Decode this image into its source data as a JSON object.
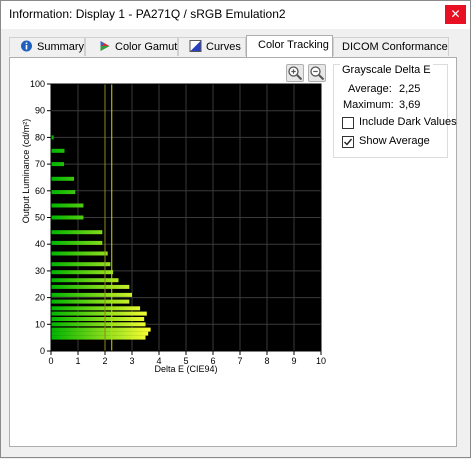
{
  "window": {
    "title": "Information: Display 1 - PA271Q / sRGB Emulation2",
    "close_glyph": "✕"
  },
  "tabs": [
    {
      "label": "Summary",
      "icon": "info-icon"
    },
    {
      "label": "Color Gamut",
      "icon": "gamut-icon"
    },
    {
      "label": "Curves",
      "icon": "curves-icon"
    },
    {
      "label": "Color Tracking",
      "icon": ""
    },
    {
      "label": "DICOM Conformance",
      "icon": ""
    }
  ],
  "active_tab": "Color Tracking",
  "stats": {
    "group_title": "Grayscale Delta E",
    "average_label": "Average:",
    "average_value": "2,25",
    "maximum_label": "Maximum:",
    "maximum_value": "3,69",
    "include_dark_label": "Include Dark Values",
    "include_dark_checked": false,
    "show_average_label": "Show Average",
    "show_average_checked": true
  },
  "chart_data": {
    "type": "bar",
    "orientation": "horizontal",
    "xlabel": "Delta E (CIE94)",
    "ylabel": "Output Luminance (cd/m²)",
    "xlim": [
      0,
      10
    ],
    "ylim": [
      0,
      100
    ],
    "xticks": [
      "0",
      "1",
      "2",
      "3",
      "4",
      "5",
      "6",
      "7",
      "8",
      "9",
      "10"
    ],
    "yticks": [
      "0",
      "10",
      "20",
      "30",
      "40",
      "50",
      "60",
      "70",
      "80",
      "90",
      "100"
    ],
    "average_line": 2.25,
    "average_line_color": "#d4d400",
    "background": "#000000",
    "grid": true,
    "bars": [
      {
        "y": 80.0,
        "x": 0.1
      },
      {
        "y": 75.0,
        "x": 0.5
      },
      {
        "y": 70.0,
        "x": 0.48
      },
      {
        "y": 64.5,
        "x": 0.85
      },
      {
        "y": 59.5,
        "x": 0.9
      },
      {
        "y": 54.5,
        "x": 1.2
      },
      {
        "y": 50.0,
        "x": 1.2
      },
      {
        "y": 44.5,
        "x": 1.9
      },
      {
        "y": 40.5,
        "x": 1.9
      },
      {
        "y": 36.5,
        "x": 2.1
      },
      {
        "y": 32.5,
        "x": 2.2
      },
      {
        "y": 29.5,
        "x": 2.3
      },
      {
        "y": 26.5,
        "x": 2.5
      },
      {
        "y": 24.0,
        "x": 2.9
      },
      {
        "y": 21.0,
        "x": 3.0
      },
      {
        "y": 18.5,
        "x": 2.9
      },
      {
        "y": 16.0,
        "x": 3.3
      },
      {
        "y": 14.0,
        "x": 3.55
      },
      {
        "y": 12.0,
        "x": 3.45
      },
      {
        "y": 10.0,
        "x": 3.5
      },
      {
        "y": 8.0,
        "x": 3.69
      },
      {
        "y": 6.5,
        "x": 3.6
      },
      {
        "y": 5.0,
        "x": 3.5
      }
    ]
  }
}
